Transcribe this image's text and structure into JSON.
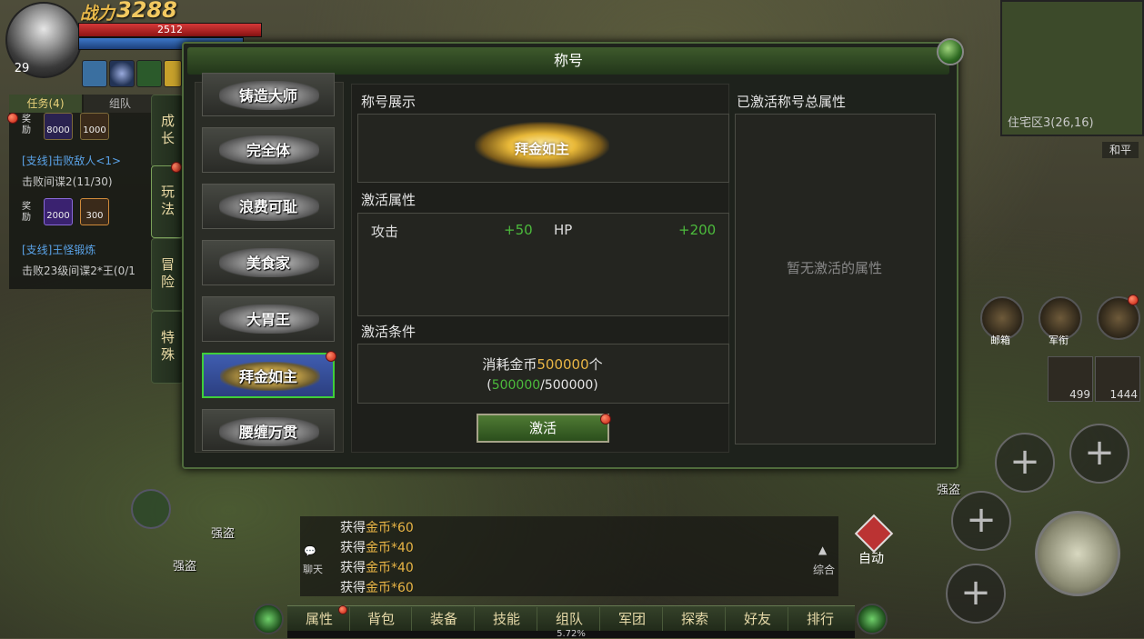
{
  "hud": {
    "power_label": "战力",
    "power_value": "3288",
    "hp_value": "2512",
    "level": "29"
  },
  "quest": {
    "tab_quest": "任务(4)",
    "tab_team": "组队",
    "reward_label": "奖励",
    "reward1": [
      "8000",
      "1000"
    ],
    "quest2_title": "[支线]击败敌人<1>",
    "quest2_progress": "击败间谍2(11/30)",
    "reward2": [
      "2000",
      "300"
    ],
    "quest3_title": "[支线]王怪锻炼",
    "quest3_progress": "击败23级间谍2*王(0/1"
  },
  "side_tabs": [
    "成长",
    "玩法",
    "冒险",
    "特殊"
  ],
  "modal": {
    "title": "称号",
    "titles_list": [
      "铸造大师",
      "完全体",
      "浪费可耻",
      "美食家",
      "大胃王",
      "拜金如主",
      "腰缠万贯"
    ],
    "selected_index": 5,
    "display_label": "称号展示",
    "display_title": "拜金如主",
    "attr_label": "激活属性",
    "attrs": [
      {
        "name": "攻击",
        "value": "+50"
      },
      {
        "name": "HP",
        "value": "+200"
      }
    ],
    "cond_label": "激活条件",
    "cond_text_prefix": "消耗金币",
    "cond_amount": "500000",
    "cond_text_suffix": "个",
    "progress_open": "(",
    "progress_current": "500000",
    "progress_total": "/500000)",
    "activate_button": "激活",
    "total_label": "已激活称号总属性",
    "total_empty": "暂无激活的属性"
  },
  "right_hud": {
    "location": "住宅区3(26,16)",
    "mode": "和平",
    "mail_label": "邮箱",
    "rank_label": "军衔",
    "item1_count": "499",
    "item2_count": "1444",
    "auto_label": "自动"
  },
  "chat": {
    "chat_label": "聊天",
    "lines": [
      {
        "prefix": "获得",
        "item": "金币*60"
      },
      {
        "prefix": "获得",
        "item": "金币*40"
      },
      {
        "prefix": "获得",
        "item": "金币*40"
      },
      {
        "prefix": "获得",
        "item": "金币*60"
      }
    ],
    "channel": "综合"
  },
  "menu": [
    "属性",
    "背包",
    "装备",
    "技能",
    "组队",
    "军团",
    "探索",
    "好友",
    "排行"
  ],
  "exp_percent": "5.72%",
  "npc_names": [
    "强盗",
    "强盗",
    "强盗"
  ],
  "colors": {
    "accent_green": "#4cbb3c",
    "gold": "#e9b545",
    "selected_border": "#3fcf39"
  }
}
